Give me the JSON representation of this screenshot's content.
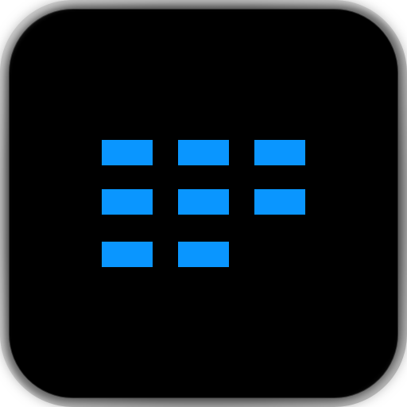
{
  "app_icon": {
    "name": "blue-blocks-grid-app-icon",
    "colors": {
      "frame": "#8a8a8a",
      "tile_background": "#000000",
      "block": "#0a96ff"
    },
    "grid": {
      "rows": 3,
      "columns": 3,
      "filled_cells": 8,
      "cells": [
        {
          "row": 1,
          "col": 1,
          "filled": true
        },
        {
          "row": 1,
          "col": 2,
          "filled": true
        },
        {
          "row": 1,
          "col": 3,
          "filled": true
        },
        {
          "row": 2,
          "col": 1,
          "filled": true
        },
        {
          "row": 2,
          "col": 2,
          "filled": true
        },
        {
          "row": 2,
          "col": 3,
          "filled": true
        },
        {
          "row": 3,
          "col": 1,
          "filled": true
        },
        {
          "row": 3,
          "col": 2,
          "filled": true
        },
        {
          "row": 3,
          "col": 3,
          "filled": false
        }
      ]
    }
  }
}
